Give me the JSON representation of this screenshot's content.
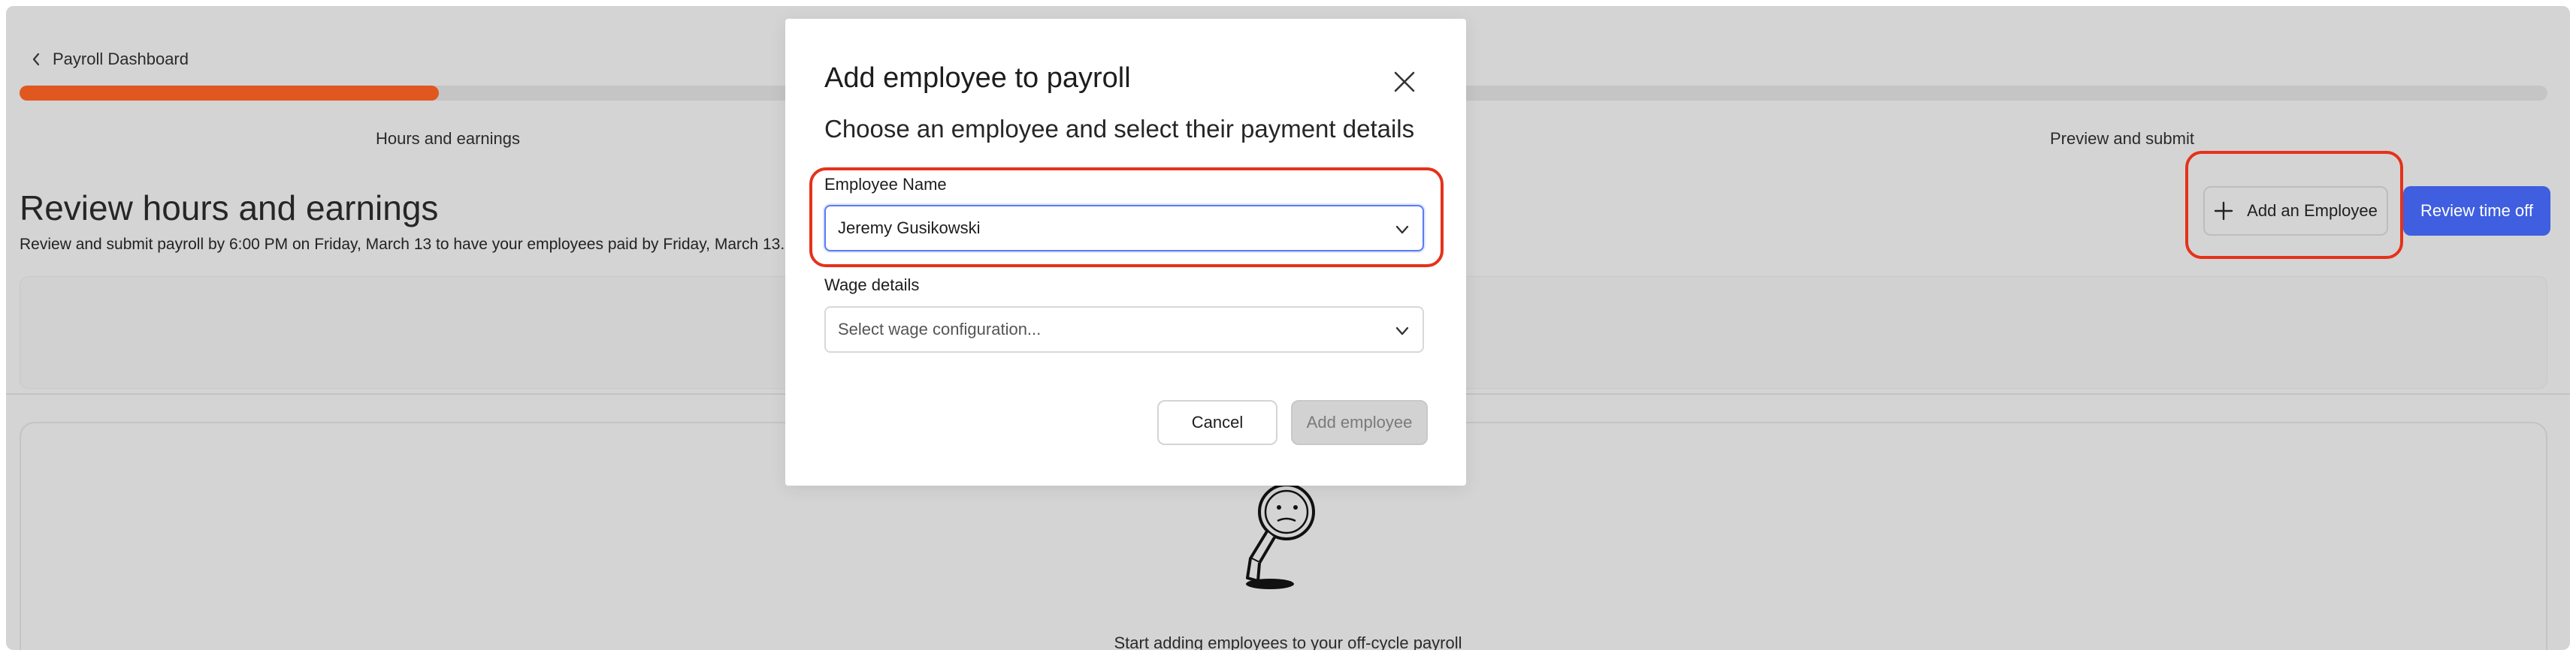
{
  "colors": {
    "accent_orange": "#e0581f",
    "primary_blue": "#3f5fe0",
    "highlight_red": "#e5321a"
  },
  "header": {
    "back_label": "Payroll Dashboard",
    "back_icon": "chevron-left-icon"
  },
  "progress": {
    "fraction": 0.166
  },
  "steps": [
    {
      "label": "Hours and earnings"
    },
    {
      "label": "Preview and submit"
    }
  ],
  "page": {
    "title": "Review hours and earnings",
    "subtitle": "Review and submit payroll by 6:00 PM on Friday, March 13 to have your employees paid by Friday, March 13.",
    "add_employee_label": "Add an Employee",
    "add_employee_icon": "plus-icon",
    "review_time_off_label": "Review time off",
    "empty_state_text": "Start adding employees to your off-cycle payroll"
  },
  "modal": {
    "title": "Add employee to payroll",
    "subtitle": "Choose an employee and select their payment details",
    "close_icon": "close-icon",
    "employee_label": "Employee Name",
    "employee_value": "Jeremy Gusikowski",
    "wage_label": "Wage details",
    "wage_placeholder": "Select wage configuration...",
    "cancel_label": "Cancel",
    "add_label": "Add employee"
  }
}
